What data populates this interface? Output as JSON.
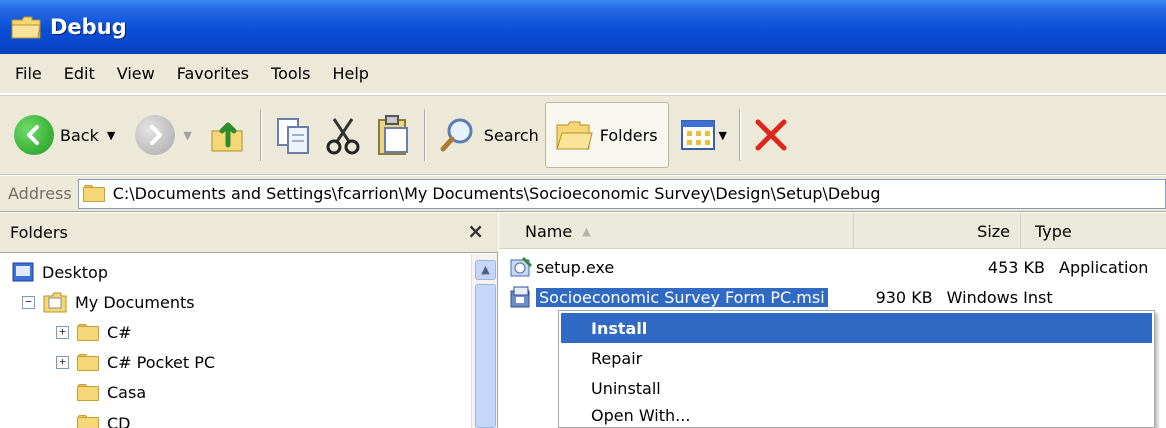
{
  "window": {
    "title": "Debug"
  },
  "menu": [
    "File",
    "Edit",
    "View",
    "Favorites",
    "Tools",
    "Help"
  ],
  "toolbar": {
    "back_label": "Back",
    "search_label": "Search",
    "folders_label": "Folders"
  },
  "address": {
    "label": "Address",
    "path": "C:\\Documents and Settings\\fcarrion\\My Documents\\Socioeconomic Survey\\Design\\Setup\\Debug"
  },
  "folders_pane": {
    "title": "Folders",
    "close_glyph": "×",
    "tree": [
      {
        "label": "Desktop"
      },
      {
        "label": "My Documents"
      },
      {
        "label": "C#"
      },
      {
        "label": "C# Pocket PC"
      },
      {
        "label": "Casa"
      },
      {
        "label": "CD"
      }
    ]
  },
  "file_list": {
    "columns": {
      "name": "Name",
      "size": "Size",
      "type": "Type"
    },
    "files": [
      {
        "name": "setup.exe",
        "size": "453 KB",
        "type": "Application"
      },
      {
        "name": "Socioeconomic Survey Form PC.msi",
        "size": "930 KB",
        "type": "Windows Inst"
      }
    ]
  },
  "context_menu": {
    "items": [
      "Install",
      "Repair",
      "Uninstall",
      "Open With..."
    ],
    "selected": "Install"
  },
  "colors": {
    "titlebar": "#0a4fd8",
    "menu_bg": "#ece9d8",
    "selection": "#316ac5",
    "delete_x": "#e0261b"
  }
}
